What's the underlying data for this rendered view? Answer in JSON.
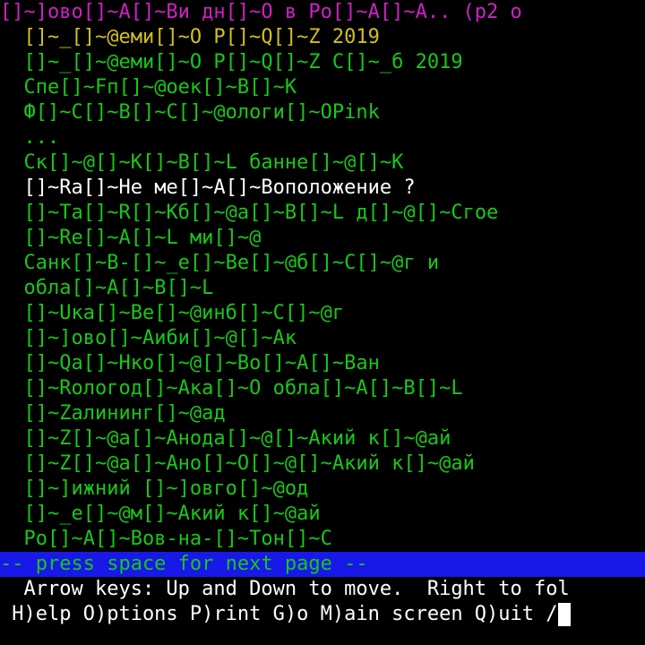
{
  "title": "[]~]ово[]~А[]~Ви дн[]~О в Ро[]~А[]~А.. (р2 о",
  "links": [
    {
      "label": "[]~_[]~@еми[]~О Р[]~Q[]~Z 2019",
      "state": "current"
    },
    {
      "label": "[]~_[]~@еми[]~О Р[]~Q[]~Z С[]~_б 2019",
      "state": "normal"
    },
    {
      "label": "Спе[]~Fп[]~@оек[]~В[]~К",
      "state": "normal"
    },
    {
      "label": "Ф[]~С[]~В[]~С[]~@ологи[]~ОPink",
      "state": "normal"
    },
    {
      "label": "...",
      "state": "normal"
    },
    {
      "label": "Ск[]~@[]~К[]~В[]~L банне[]~@[]~К",
      "state": "normal"
    },
    {
      "label": "[]~Ra[]~Не ме[]~А[]~Воположение ?",
      "state": "selected"
    },
    {
      "label": "[]~Ta[]~R[]~Кб[]~@а[]~В[]~L д[]~@[]~Сгое",
      "state": "normal"
    },
    {
      "label": "[]~Re[]~А[]~L ми[]~@",
      "state": "normal"
    },
    {
      "label": "Санк[]~В-[]~_е[]~Ве[]~@б[]~С[]~@г и",
      "state": "normal"
    },
    {
      "label": "обла[]~А[]~В[]~L",
      "state": "normal"
    },
    {
      "label": "[]~Uка[]~Ве[]~@инб[]~С[]~@г",
      "state": "normal"
    },
    {
      "label": "[]~]ово[]~Аиби[]~@[]~Ак",
      "state": "normal"
    },
    {
      "label": "[]~Qa[]~Нко[]~@[]~Во[]~А[]~Ван",
      "state": "normal"
    },
    {
      "label": "[]~Rологод[]~Ака[]~О обла[]~А[]~В[]~L",
      "state": "normal"
    },
    {
      "label": "[]~Zалининг[]~@ад",
      "state": "normal"
    },
    {
      "label": "[]~Z[]~@а[]~Анода[]~@[]~Акий к[]~@ай",
      "state": "normal"
    },
    {
      "label": "[]~Z[]~@а[]~Ано[]~О[]~@[]~Акий к[]~@ай",
      "state": "normal"
    },
    {
      "label": "[]~]ижний []~]овго[]~@од",
      "state": "normal"
    },
    {
      "label": "[]~_е[]~@м[]~Акий к[]~@ай",
      "state": "normal"
    },
    {
      "label": "Ро[]~А[]~Вов-на-[]~Тон[]~С",
      "state": "normal"
    }
  ],
  "status_bar": "-- press space for next page --",
  "help_line_1": "  Arrow keys: Up and Down to move.  Right to fol",
  "help_line_2": " H)elp O)ptions P)rint G)o M)ain screen Q)uit /",
  "colors": {
    "background": "#000000",
    "title": "#d020c8",
    "link": "#18c818",
    "current_link": "#d0c020",
    "selected_link": "#ffffff",
    "status_bar_bg": "#1818e8",
    "status_bar_fg": "#18c818",
    "help_text": "#ffffff"
  }
}
